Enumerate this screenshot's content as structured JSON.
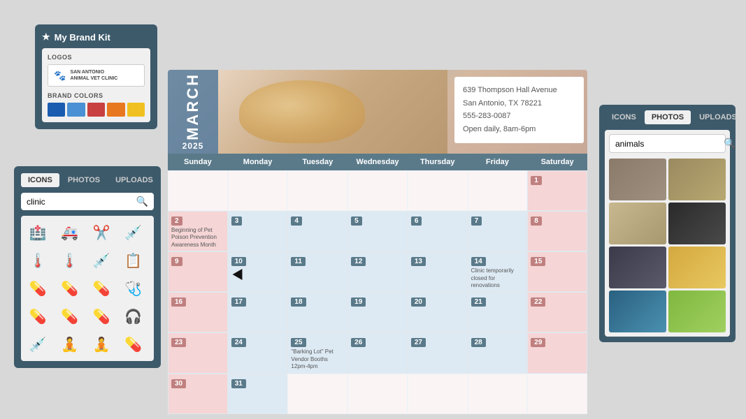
{
  "brand_kit": {
    "title": "My Brand Kit",
    "star_icon": "★",
    "sections": {
      "logos_label": "LOGOS",
      "logo_paw_icon": "🐾",
      "logo_name_line1": "SAN ANTONIO",
      "logo_name_line2": "ANIMAL VET CLINIC",
      "colors_label": "BRAND COLORS",
      "colors": [
        "#1a5cb0",
        "#4a90d4",
        "#c84040",
        "#e87820",
        "#f0c020"
      ]
    }
  },
  "icons_panel": {
    "tabs": [
      "ICONS",
      "PHOTOS",
      "UPLOADS"
    ],
    "active_tab": "ICONS",
    "search_placeholder": "clinic",
    "search_icon": "🔍",
    "icons": [
      "🏥",
      "🚑",
      "✂",
      "💉",
      "🌡",
      "🌡",
      "💊",
      "📋",
      "💊",
      "💊",
      "🩺",
      "🩺",
      "💊",
      "💊",
      "💊",
      "🩺",
      "💉",
      "🧘",
      "🧘",
      "💊"
    ]
  },
  "calendar": {
    "month": "MARCH",
    "year": "2025",
    "address": {
      "line1": "639 Thompson Hall Avenue",
      "line2": "San Antonio, TX 78221",
      "line3": "555-283-0087",
      "line4": "Open daily, 8am-6pm"
    },
    "days_header": [
      "Sunday",
      "Monday",
      "Tuesday",
      "Wednesday",
      "Thursday",
      "Friday",
      "Saturday"
    ],
    "weeks": [
      [
        {
          "num": "",
          "type": "empty",
          "note": ""
        },
        {
          "num": "",
          "type": "empty",
          "note": ""
        },
        {
          "num": "",
          "type": "empty",
          "note": ""
        },
        {
          "num": "",
          "type": "empty",
          "note": ""
        },
        {
          "num": "",
          "type": "empty",
          "note": ""
        },
        {
          "num": "",
          "type": "empty",
          "note": ""
        },
        {
          "num": "1",
          "type": "saturday",
          "note": ""
        }
      ],
      [
        {
          "num": "2",
          "type": "sunday",
          "note": ""
        },
        {
          "num": "3",
          "type": "weekday",
          "note": ""
        },
        {
          "num": "4",
          "type": "weekday",
          "note": ""
        },
        {
          "num": "5",
          "type": "weekday",
          "note": ""
        },
        {
          "num": "6",
          "type": "weekday",
          "note": ""
        },
        {
          "num": "7",
          "type": "weekday",
          "note": ""
        },
        {
          "num": "8",
          "type": "saturday",
          "note": ""
        }
      ],
      [
        {
          "num": "9",
          "type": "sunday",
          "note": ""
        },
        {
          "num": "10",
          "type": "weekday",
          "note": ""
        },
        {
          "num": "11",
          "type": "weekday",
          "note": ""
        },
        {
          "num": "12",
          "type": "weekday",
          "note": ""
        },
        {
          "num": "13",
          "type": "weekday",
          "note": ""
        },
        {
          "num": "14",
          "type": "weekday",
          "note": ""
        },
        {
          "num": "15",
          "type": "saturday",
          "note": ""
        }
      ],
      [
        {
          "num": "16",
          "type": "sunday",
          "note": ""
        },
        {
          "num": "17",
          "type": "weekday",
          "note": ""
        },
        {
          "num": "18",
          "type": "weekday",
          "note": ""
        },
        {
          "num": "19",
          "type": "weekday",
          "note": ""
        },
        {
          "num": "20",
          "type": "weekday",
          "note": ""
        },
        {
          "num": "21",
          "type": "weekday",
          "note": ""
        },
        {
          "num": "22",
          "type": "saturday",
          "note": ""
        }
      ],
      [
        {
          "num": "23",
          "type": "sunday",
          "note": ""
        },
        {
          "num": "24",
          "type": "weekday",
          "note": ""
        },
        {
          "num": "25",
          "type": "weekday",
          "note": "'Barking Lot' Pet Vendor Booths 12pm-4pm"
        },
        {
          "num": "26",
          "type": "weekday",
          "note": ""
        },
        {
          "num": "27",
          "type": "weekday",
          "note": ""
        },
        {
          "num": "28",
          "type": "weekday",
          "note": ""
        },
        {
          "num": "29",
          "type": "saturday",
          "note": ""
        }
      ],
      [
        {
          "num": "30",
          "type": "sunday",
          "note": ""
        },
        {
          "num": "31",
          "type": "weekday",
          "note": ""
        },
        {
          "num": "",
          "type": "empty",
          "note": ""
        },
        {
          "num": "",
          "type": "empty",
          "note": ""
        },
        {
          "num": "",
          "type": "empty",
          "note": ""
        },
        {
          "num": "",
          "type": "empty",
          "note": ""
        },
        {
          "num": "",
          "type": "empty",
          "note": ""
        }
      ]
    ],
    "special_notes": {
      "1": "Beginning of Pet Poison Prevention Awareness Month",
      "14": "Clinic temporarily closed for renovations"
    }
  },
  "right_panel": {
    "tabs": [
      "ICONS",
      "PHOTOS",
      "UPLOADS"
    ],
    "active_tab": "PHOTOS",
    "search_placeholder": "animals",
    "search_icon": "🔍"
  }
}
